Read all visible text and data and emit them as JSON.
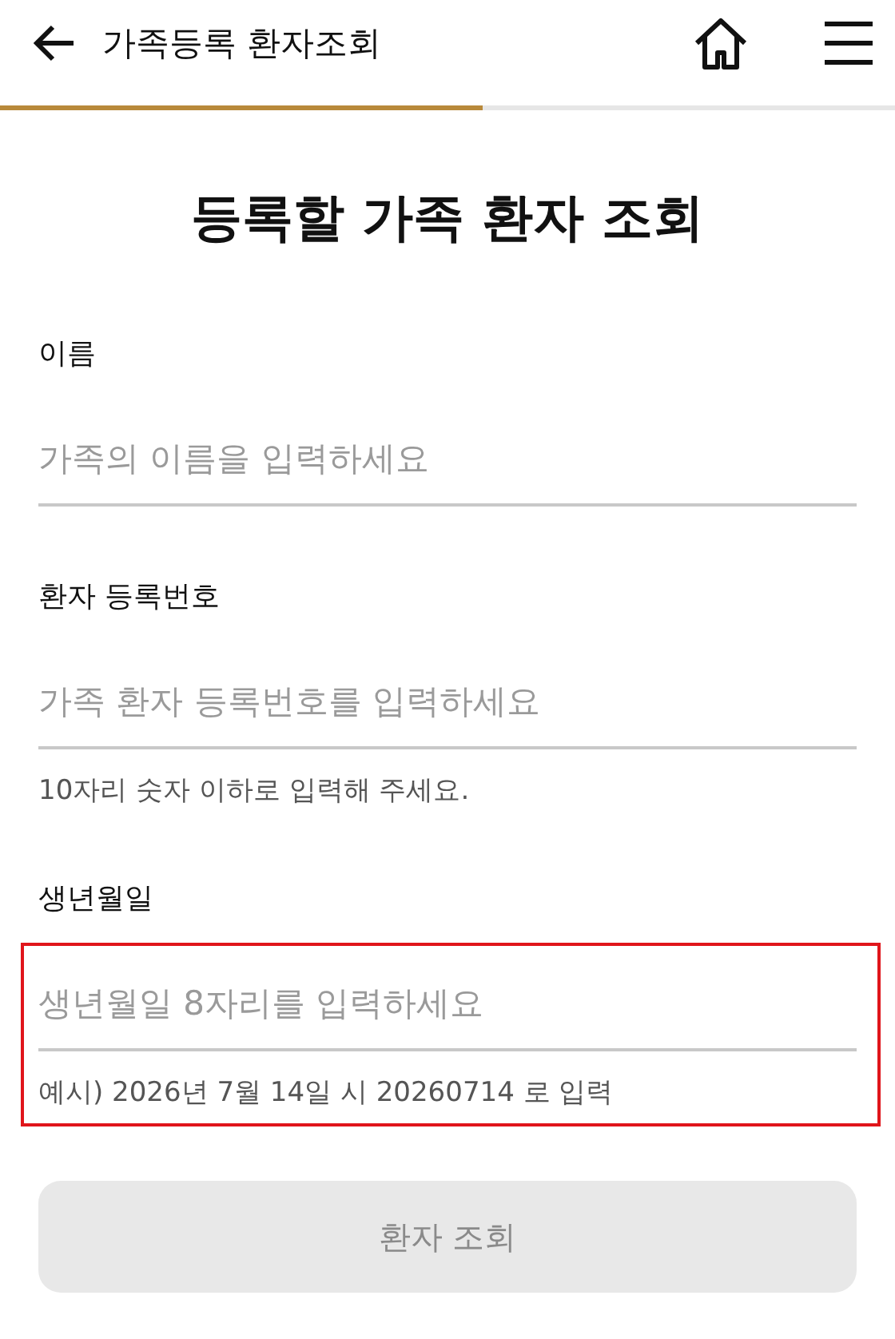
{
  "header": {
    "title": "가족등록 환자조회"
  },
  "progress": {
    "level": 0.54
  },
  "heading": "등록할 가족 환자 조회",
  "fields": [
    {
      "label": "이름",
      "placeholder": "가족의 이름을 입력하세요",
      "highlighted": false
    },
    {
      "label": "환자 등록번호",
      "placeholder": "가족 환자 등록번호를 입력하세요",
      "hint": "10자리 숫자 이하로 입력해 주세요.",
      "highlighted": false
    },
    {
      "label": "생년월일",
      "placeholder": "생년월일 8자리를 입력하세요",
      "hint": "예시) 2026년 7월 14일 시 20260714 로 입력",
      "highlighted": true
    }
  ],
  "submit": {
    "label": "환자 조회",
    "disabled": true
  }
}
